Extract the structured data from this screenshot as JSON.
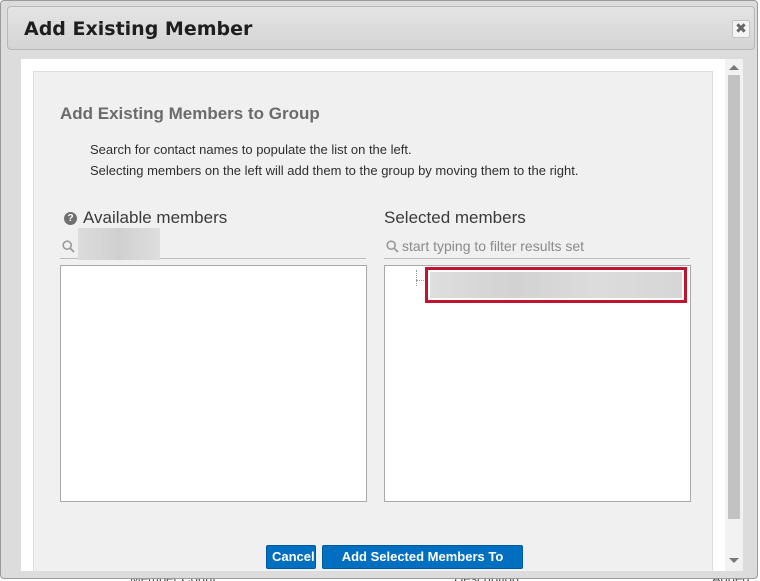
{
  "dialog": {
    "title": "Add Existing Member",
    "close_glyph": "✖",
    "heading": "Add Existing Members to Group",
    "instructions": [
      "Search for contact names to populate the list on the left.",
      "Selecting members on the left will add them to the group by moving them to the right."
    ],
    "available": {
      "label": "Available members",
      "help_glyph": "?",
      "search_value": ""
    },
    "selected": {
      "label": "Selected members",
      "search_placeholder": "start typing to filter results set"
    },
    "buttons": {
      "cancel": "Cancel",
      "add": "Add Selected Members To Group"
    }
  },
  "background": {
    "columns": [
      "Member Count",
      "Description",
      "Added"
    ]
  },
  "colors": {
    "primary_button": "#006fbf",
    "selection_highlight": "#c0152f"
  },
  "icons": [
    "close-icon",
    "help-icon",
    "search-icon"
  ]
}
